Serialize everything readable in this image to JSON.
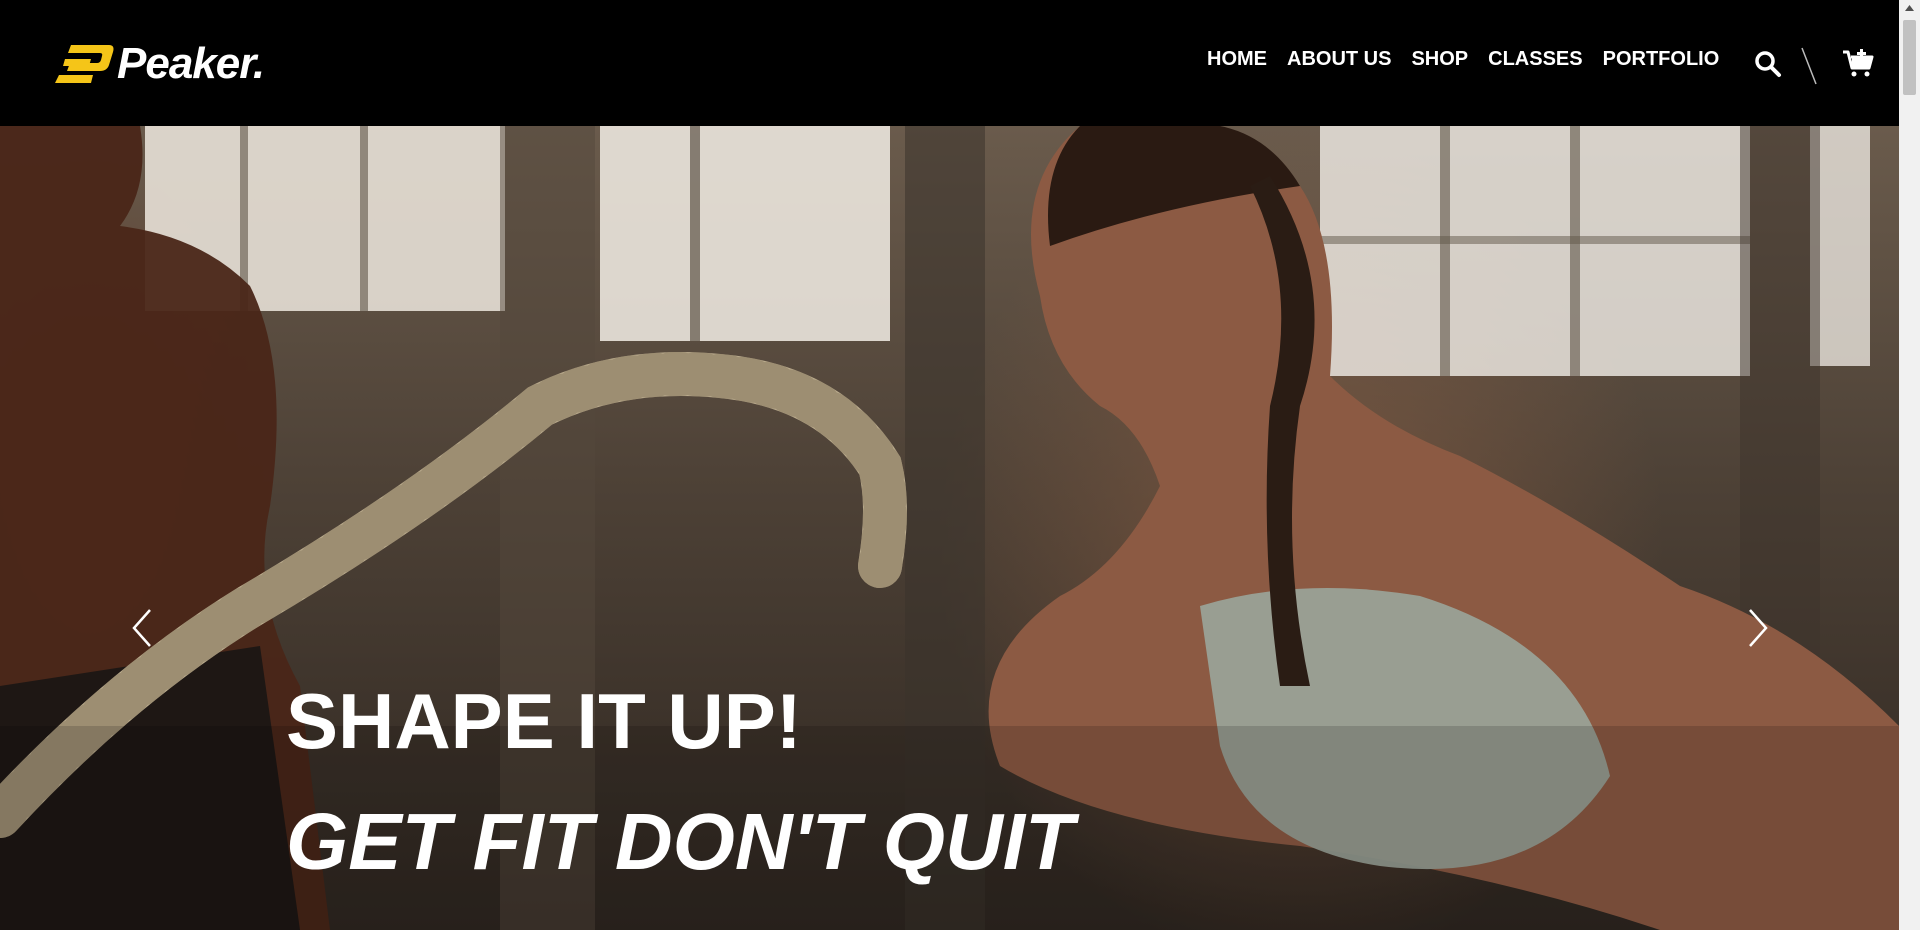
{
  "brand": {
    "name": "Peaker.",
    "accent": "#f5c518"
  },
  "nav": {
    "items": [
      {
        "label": "HOME"
      },
      {
        "label": "ABOUT US"
      },
      {
        "label": "SHOP"
      },
      {
        "label": "CLASSES"
      },
      {
        "label": "PORTFOLIO"
      }
    ]
  },
  "icons": {
    "search": "search-icon",
    "cart": "cart-icon",
    "prev": "chevron-left-icon",
    "next": "chevron-right-icon"
  },
  "hero": {
    "headline": "SHAPE IT UP!",
    "subline": "GET FIT DON'T QUIT"
  }
}
